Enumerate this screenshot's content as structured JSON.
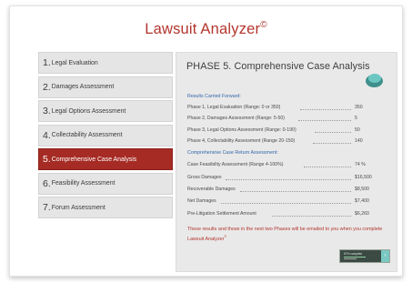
{
  "app": {
    "title": "Lawsuit Analyzer",
    "title_mark": "©"
  },
  "sidebar": {
    "items": [
      {
        "num": "1.",
        "label": "Legal Evaluation",
        "active": false
      },
      {
        "num": "2.",
        "label": "Damages Assessment",
        "active": false
      },
      {
        "num": "3.",
        "label": "Legal Options Assessment",
        "active": false
      },
      {
        "num": "4.",
        "label": "Collectability Assessment",
        "active": false
      },
      {
        "num": "5.",
        "label": "Comprehensive Case Analysis",
        "active": true
      },
      {
        "num": "6.",
        "label": "Feasibility Assessment",
        "active": false
      },
      {
        "num": "7.",
        "label": "Forum Assessment",
        "active": false
      }
    ]
  },
  "panel": {
    "title": "PHASE 5. Comprehensive Case Analysis",
    "results_heading": "Results Carried Forward:",
    "results": [
      {
        "label": "Phase 1, Legal Evaluation (Range: 0 or 350)",
        "value": "350"
      },
      {
        "label": "Phase 2, Damages Assessment (Range: 5-50)",
        "value": "5"
      },
      {
        "label": "Phase 3, Legal Options Assessment (Range: 0-190)",
        "value": "50"
      },
      {
        "label": "Phase 4, Collectability Assessment (Range 20-150)",
        "value": "140"
      }
    ],
    "return_heading": "Comprehensive Case Return Assessment:",
    "returns": [
      {
        "label": "Case Feasibility Assessment (Range 4-100%)",
        "value": "74 %"
      },
      {
        "label": "Gross Damages",
        "value": "$16,500"
      },
      {
        "label": "Recoverable Damages",
        "value": "$8,500"
      },
      {
        "label": "Net Damages",
        "value": "$7,400"
      },
      {
        "label": "Pre-Litigation Settlement Amount",
        "value": "$6,260"
      }
    ],
    "note": "These results and those in the next two Phases will be emailed to you when you complete Lawsuit Analyzer",
    "note_mark": "©",
    "next_button": {
      "text": "57% complete",
      "arrow": "›"
    }
  },
  "colors": {
    "brand_red": "#b3352d",
    "active_nav": "#a52b24",
    "heading_blue": "#3366aa",
    "teal": "#6cc7c2"
  }
}
